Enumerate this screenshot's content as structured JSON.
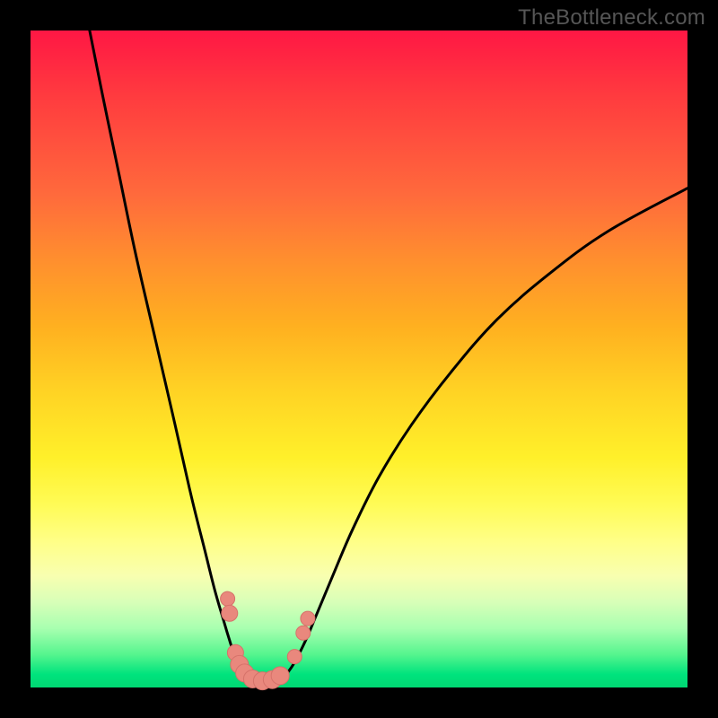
{
  "watermark": "TheBottleneck.com",
  "colors": {
    "background": "#000000",
    "curve_stroke": "#000000",
    "marker_fill": "#e9887d",
    "marker_stroke": "#d6726a"
  },
  "chart_data": {
    "type": "line",
    "title": "",
    "xlabel": "",
    "ylabel": "",
    "xlim": [
      0,
      100
    ],
    "ylim": [
      0,
      100
    ],
    "grid": false,
    "legend": false,
    "series": [
      {
        "name": "left-curve",
        "x": [
          9.0,
          11.0,
          13.5,
          16.0,
          19.0,
          22.0,
          24.5,
          26.5,
          28.0,
          29.3,
          30.2,
          31.0,
          32.0,
          33.5
        ],
        "y": [
          100.0,
          90.0,
          78.0,
          66.0,
          53.0,
          40.0,
          29.0,
          21.0,
          15.0,
          10.5,
          7.5,
          5.0,
          2.5,
          0.5
        ]
      },
      {
        "name": "right-curve",
        "x": [
          38.0,
          40.0,
          41.8,
          43.5,
          46.0,
          49.0,
          53.0,
          58.0,
          64.0,
          71.0,
          79.0,
          88.0,
          100.0
        ],
        "y": [
          0.8,
          3.5,
          7.0,
          11.0,
          17.0,
          24.0,
          32.0,
          40.0,
          48.0,
          56.0,
          63.0,
          69.5,
          76.0
        ]
      },
      {
        "name": "markers",
        "type": "scatter",
        "points": [
          {
            "x": 30.0,
            "y": 13.5,
            "r": 8
          },
          {
            "x": 30.3,
            "y": 11.3,
            "r": 9
          },
          {
            "x": 31.2,
            "y": 5.3,
            "r": 9
          },
          {
            "x": 31.8,
            "y": 3.5,
            "r": 10
          },
          {
            "x": 32.6,
            "y": 2.2,
            "r": 10
          },
          {
            "x": 33.8,
            "y": 1.3,
            "r": 10
          },
          {
            "x": 35.3,
            "y": 1.0,
            "r": 10
          },
          {
            "x": 36.8,
            "y": 1.2,
            "r": 10
          },
          {
            "x": 38.0,
            "y": 1.8,
            "r": 10
          },
          {
            "x": 40.2,
            "y": 4.7,
            "r": 8
          },
          {
            "x": 41.5,
            "y": 8.3,
            "r": 8
          },
          {
            "x": 42.2,
            "y": 10.5,
            "r": 8
          }
        ]
      }
    ]
  }
}
